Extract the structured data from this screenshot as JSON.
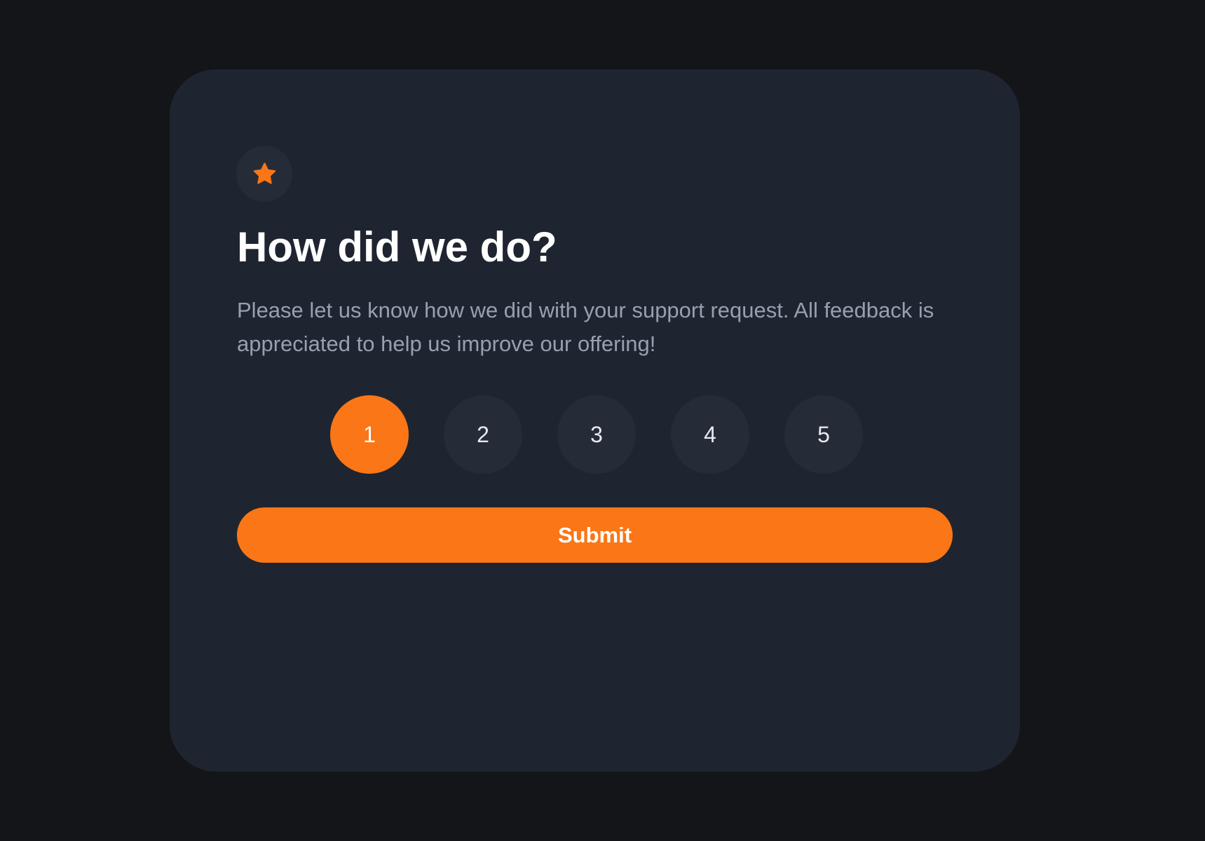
{
  "card": {
    "icon": "star-icon",
    "title": "How did we do?",
    "description": "Please let us know how we did with your support request. All feedback is appreciated to help us improve our offering!",
    "ratings": [
      {
        "label": "1",
        "selected": true
      },
      {
        "label": "2",
        "selected": false
      },
      {
        "label": "3",
        "selected": false
      },
      {
        "label": "4",
        "selected": false
      },
      {
        "label": "5",
        "selected": false
      }
    ],
    "selected_rating": "1",
    "submit_label": "Submit"
  },
  "colors": {
    "page_background": "#131518",
    "card_background": "#1f2530",
    "badge_background": "#262c37",
    "accent": "#fb7616",
    "title_text": "#ffffff",
    "description_text": "#96a0b0"
  }
}
